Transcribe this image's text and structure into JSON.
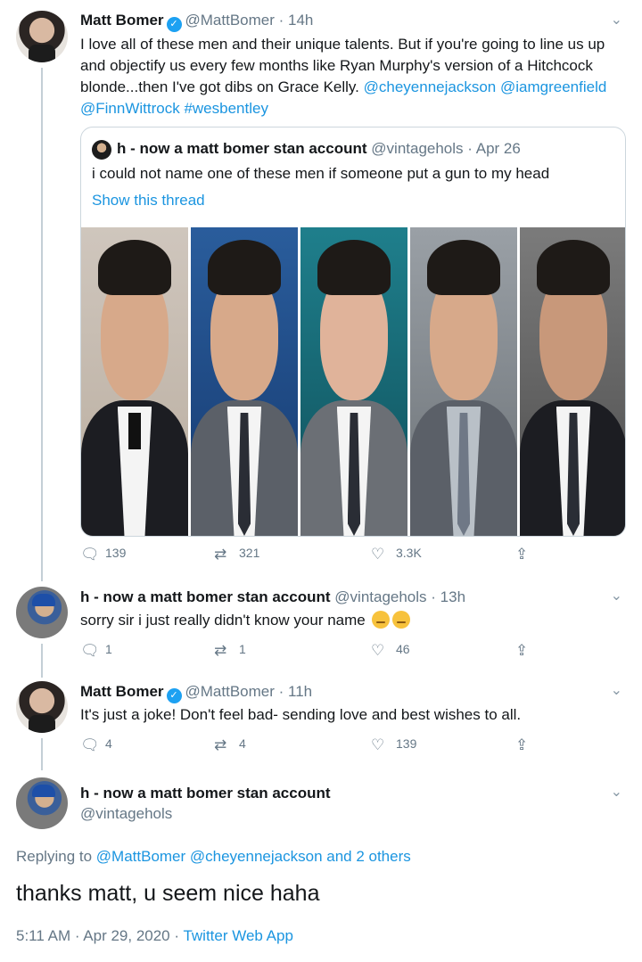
{
  "tweet1": {
    "name": "Matt Bomer",
    "handle": "@MattBomer",
    "time": "· 14h",
    "text_prefix": "I love all of these men and their unique talents. But if you're going to line us up and objectify us every few months like Ryan Murphy's version of a Hitchcock blonde...then I've got dibs on Grace Kelly. ",
    "mentions": [
      "@cheyennejackson",
      "@iamgreenfield",
      "@FinnWittrock",
      "#wesbentley"
    ],
    "quote": {
      "name": "h - now a matt bomer stan account",
      "handle": "@vintagehols",
      "time": "· Apr 26",
      "text": "i could not name one of these men if someone put a gun to my head",
      "show_thread": "Show this thread"
    },
    "replies": "139",
    "retweets": "321",
    "likes": "3.3K"
  },
  "tweet2": {
    "name": "h - now a matt bomer stan account",
    "handle": "@vintagehols",
    "time": "· 13h",
    "text": "sorry sir i just really didn't know your name",
    "replies": "1",
    "retweets": "1",
    "likes": "46"
  },
  "tweet3": {
    "name": "Matt Bomer",
    "handle": "@MattBomer",
    "time": "· 11h",
    "text": "It's just a joke! Don't feel bad- sending love and best wishes to all.",
    "replies": "4",
    "retweets": "4",
    "likes": "139"
  },
  "main": {
    "name": "h - now a matt bomer stan account",
    "handle": "@vintagehols",
    "replying_prefix": "Replying to ",
    "replying_links": "@MattBomer @cheyennejackson and 2 others",
    "text": "thanks matt, u seem nice haha",
    "timestamp": "5:11 AM · Apr 29, 2020 · ",
    "client": "Twitter Web App"
  },
  "icons": {
    "verified": "verified-badge-icon",
    "chevron": "chevron-down-icon",
    "reply": "reply-icon",
    "retweet": "retweet-icon",
    "like": "heart-icon",
    "share": "share-icon"
  },
  "colors": {
    "link": "#1b95e0",
    "verified": "#1da1f2",
    "muted": "#657786"
  }
}
